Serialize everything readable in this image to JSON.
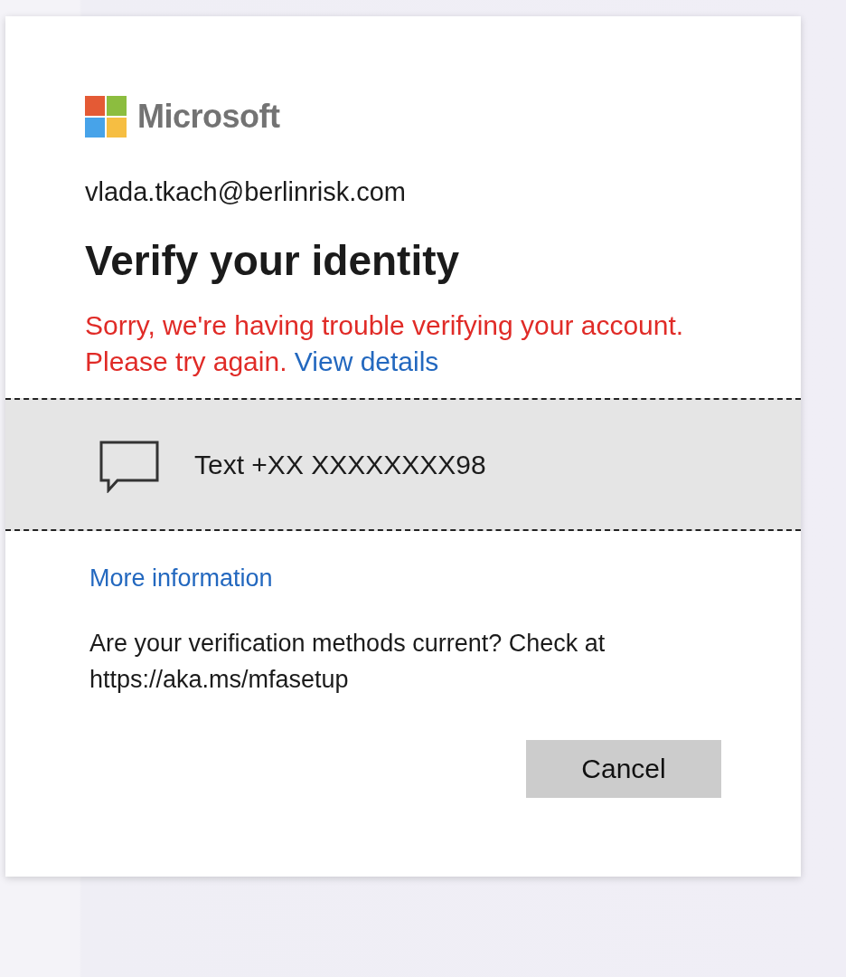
{
  "logo": {
    "text": "Microsoft"
  },
  "account": "vlada.tkach@berlinrisk.com",
  "title": "Verify your identity",
  "error": {
    "message": "Sorry, we're having trouble verifying your account. Please try again.",
    "link": "View details"
  },
  "methods": [
    {
      "kind": "sms",
      "label": "Text +XX XXXXXXXX98",
      "selected": true
    }
  ],
  "more_info_link": "More information",
  "note": "Are your verification methods current? Check at https://aka.ms/mfasetup",
  "buttons": [
    {
      "kind": "cancel",
      "label": "Cancel"
    }
  ]
}
